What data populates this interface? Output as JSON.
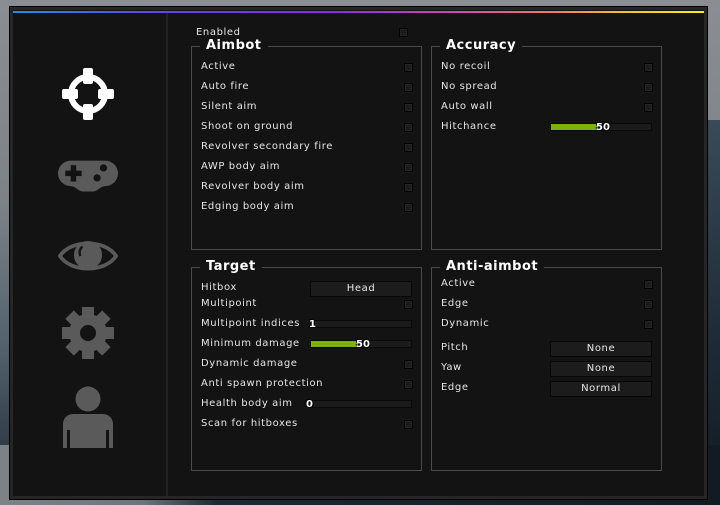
{
  "colors": {
    "accent_slider": "#7fb10d",
    "icon_active": "#ffffff",
    "icon_inactive": "#5a5a5a",
    "panel_bg": "#131313"
  },
  "sidebar": {
    "tabs": [
      {
        "name": "aimbot",
        "icon": "crosshair-icon",
        "active": true
      },
      {
        "name": "misc",
        "icon": "gamepad-icon",
        "active": false
      },
      {
        "name": "visuals",
        "icon": "eye-icon",
        "active": false
      },
      {
        "name": "settings",
        "icon": "gear-icon",
        "active": false
      },
      {
        "name": "player",
        "icon": "user-icon",
        "active": false
      }
    ]
  },
  "enabled": {
    "label": "Enabled",
    "checked": false
  },
  "aimbot": {
    "title": "Aimbot",
    "items": [
      {
        "label": "Active",
        "checked": false
      },
      {
        "label": "Auto fire",
        "checked": false
      },
      {
        "label": "Silent aim",
        "checked": false
      },
      {
        "label": "Shoot on ground",
        "checked": false
      },
      {
        "label": "Revolver secondary fire",
        "checked": false
      },
      {
        "label": "AWP body aim",
        "checked": false
      },
      {
        "label": "Revolver body aim",
        "checked": false
      },
      {
        "label": "Edging body aim",
        "checked": false
      }
    ]
  },
  "accuracy": {
    "title": "Accuracy",
    "items": [
      {
        "label": "No recoil",
        "checked": false
      },
      {
        "label": "No spread",
        "checked": false
      },
      {
        "label": "Auto wall",
        "checked": false
      }
    ],
    "hitchance": {
      "label": "Hitchance",
      "value": "50",
      "fraction": 0.5
    }
  },
  "target": {
    "title": "Target",
    "hitbox": {
      "label": "Hitbox",
      "value": "Head"
    },
    "multipoint": {
      "label": "Multipoint",
      "checked": false
    },
    "multipoint_indices": {
      "label": "Multipoint indices",
      "value": "1",
      "fraction": 0.03
    },
    "minimum_damage": {
      "label": "Minimum damage",
      "value": "50",
      "fraction": 0.5
    },
    "dynamic_damage": {
      "label": "Dynamic damage",
      "checked": false
    },
    "anti_spawn": {
      "label": "Anti spawn protection",
      "checked": false
    },
    "health_body_aim": {
      "label": "Health body aim",
      "value": "0",
      "fraction": 0
    },
    "scan_hitboxes": {
      "label": "Scan for hitboxes",
      "checked": false
    }
  },
  "antiaim": {
    "title": "Anti-aimbot",
    "items": [
      {
        "label": "Active",
        "checked": false
      },
      {
        "label": "Edge",
        "checked": false
      },
      {
        "label": "Dynamic",
        "checked": false
      }
    ],
    "pitch": {
      "label": "Pitch",
      "value": "None"
    },
    "yaw": {
      "label": "Yaw",
      "value": "None"
    },
    "edge": {
      "label": "Edge",
      "value": "Normal"
    }
  }
}
